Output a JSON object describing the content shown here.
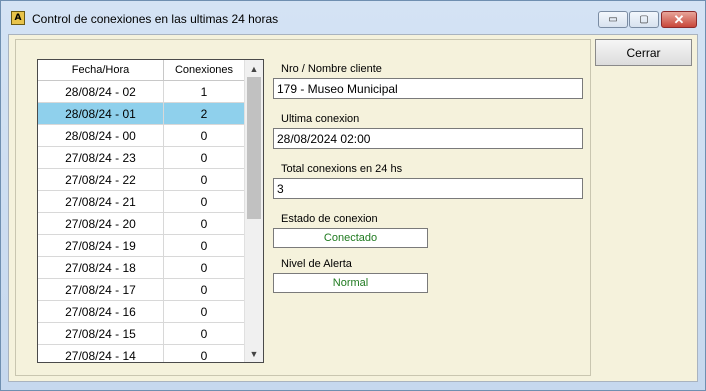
{
  "window": {
    "title": "Control de conexiones en las ultimas 24 horas",
    "icon_letter": "A",
    "controls": {
      "minimize": "▭",
      "maximize": "▢",
      "close": "✕"
    }
  },
  "grid": {
    "headers": {
      "datetime": "Fecha/Hora",
      "connections": "Conexiones"
    },
    "rows": [
      {
        "datetime": "28/08/24 - 02",
        "connections": "1",
        "selected": false
      },
      {
        "datetime": "28/08/24 - 01",
        "connections": "2",
        "selected": true
      },
      {
        "datetime": "28/08/24 - 00",
        "connections": "0",
        "selected": false
      },
      {
        "datetime": "27/08/24 - 23",
        "connections": "0",
        "selected": false
      },
      {
        "datetime": "27/08/24 - 22",
        "connections": "0",
        "selected": false
      },
      {
        "datetime": "27/08/24 - 21",
        "connections": "0",
        "selected": false
      },
      {
        "datetime": "27/08/24 - 20",
        "connections": "0",
        "selected": false
      },
      {
        "datetime": "27/08/24 - 19",
        "connections": "0",
        "selected": false
      },
      {
        "datetime": "27/08/24 - 18",
        "connections": "0",
        "selected": false
      },
      {
        "datetime": "27/08/24 - 17",
        "connections": "0",
        "selected": false
      },
      {
        "datetime": "27/08/24 - 16",
        "connections": "0",
        "selected": false
      },
      {
        "datetime": "27/08/24 - 15",
        "connections": "0",
        "selected": false
      },
      {
        "datetime": "27/08/24 - 14",
        "connections": "0",
        "selected": false
      }
    ],
    "scroll_icons": {
      "up": "▲",
      "down": "▼"
    }
  },
  "details": {
    "client_label": "Nro / Nombre cliente",
    "client_value": "179 - Museo Municipal",
    "last_conn_label": "Ultima conexion",
    "last_conn_value": "28/08/2024 02:00",
    "total_label": "Total conexions en 24 hs",
    "total_value": "3",
    "state_label": "Estado de conexion",
    "state_value": "Conectado",
    "alert_label": "Nivel de Alerta",
    "alert_value": "Normal"
  },
  "actions": {
    "close_label": "Cerrar"
  },
  "colors": {
    "selected_row": "#8fd0ec",
    "status_text": "#1f7a1f",
    "client_bg": "#f5f2dc"
  }
}
